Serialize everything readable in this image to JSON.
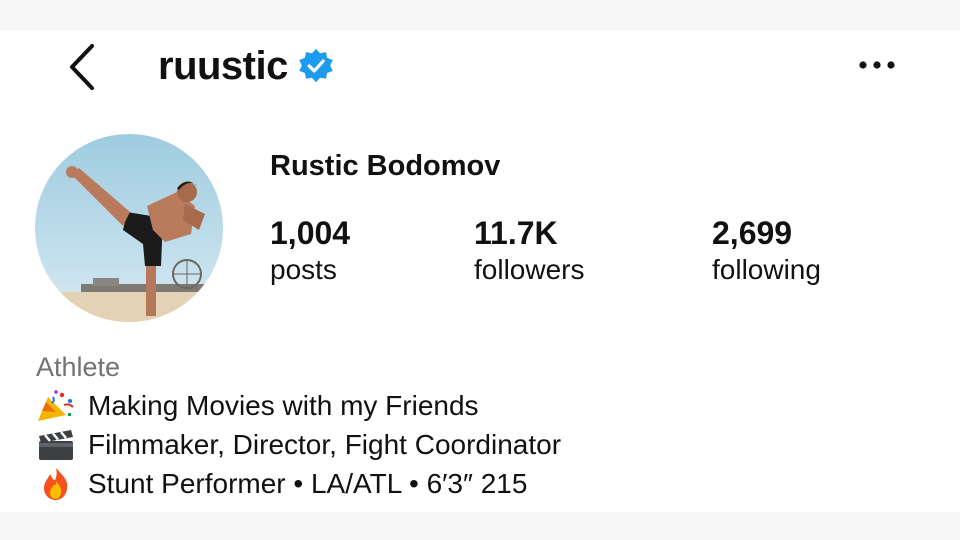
{
  "header": {
    "username": "ruustic",
    "back_icon": "chevron-left-icon",
    "verified_icon": "verified-badge-icon",
    "more_icon": "more-horizontal-icon",
    "verified_color": "#1d9bf0"
  },
  "profile": {
    "display_name": "Rustic Bodomov",
    "avatar_alt": "profile photo"
  },
  "stats": [
    {
      "value": "1,004",
      "label": "posts"
    },
    {
      "value": "11.7K",
      "label": "followers"
    },
    {
      "value": "2,699",
      "label": "following"
    }
  ],
  "bio": {
    "category": "Athlete",
    "lines": [
      {
        "icon": "party-popper-icon",
        "text": "Making Movies with my Friends"
      },
      {
        "icon": "clapper-board-icon",
        "text": "Filmmaker, Director, Fight Coordinator"
      },
      {
        "icon": "fire-icon",
        "text": "Stunt Performer • LA/ATL • 6′3″ 215"
      }
    ]
  }
}
